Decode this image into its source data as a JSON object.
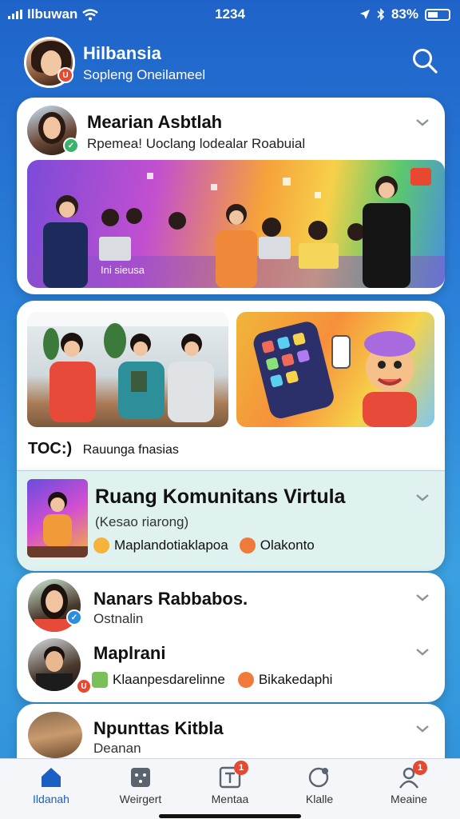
{
  "status": {
    "carrier": "Ilbuwan",
    "time": "1234",
    "battery": "83%"
  },
  "header": {
    "name": "Hilbansia",
    "subtitle": "Sopleng Oneilameel"
  },
  "feed": {
    "card1": {
      "title": "Mearian Asbtlah",
      "subtitle": "Rpemea! Uoclang lodealar Roabuial",
      "banner_text": "Ini sieusa"
    },
    "card2": {
      "caption_bold": "TOC:)",
      "caption_text": "Rauunga fnasias"
    },
    "card3": {
      "title": "Ruang Komunitans Virtula",
      "subtitle": "(Kesao riarong)",
      "tag1": "Maplandotiaklapoa",
      "tag2": "Olakonto"
    },
    "card4": {
      "row1": {
        "name": "Nanars Rabbabos.",
        "sub": "Ostnalin"
      },
      "row2": {
        "name": "Maplrani",
        "tag1": "Klaanpesdarelinne",
        "tag2": "Bikakedaphi"
      }
    },
    "card5": {
      "name": "Npunttas Kitbla",
      "sub": "Deanan"
    }
  },
  "tabs": [
    {
      "label": "Ildanah",
      "icon": "home-icon",
      "active": true
    },
    {
      "label": "Weirgert",
      "icon": "games-icon"
    },
    {
      "label": "Mentaa",
      "icon": "inbox-icon",
      "badge": "1"
    },
    {
      "label": "Klalle",
      "icon": "chat-icon"
    },
    {
      "label": "Meaine",
      "icon": "profile-icon",
      "badge": "1"
    }
  ],
  "colors": {
    "accent": "#1a5fc4",
    "badge": "#e8482f",
    "highlight_card": "#dff2f0"
  }
}
